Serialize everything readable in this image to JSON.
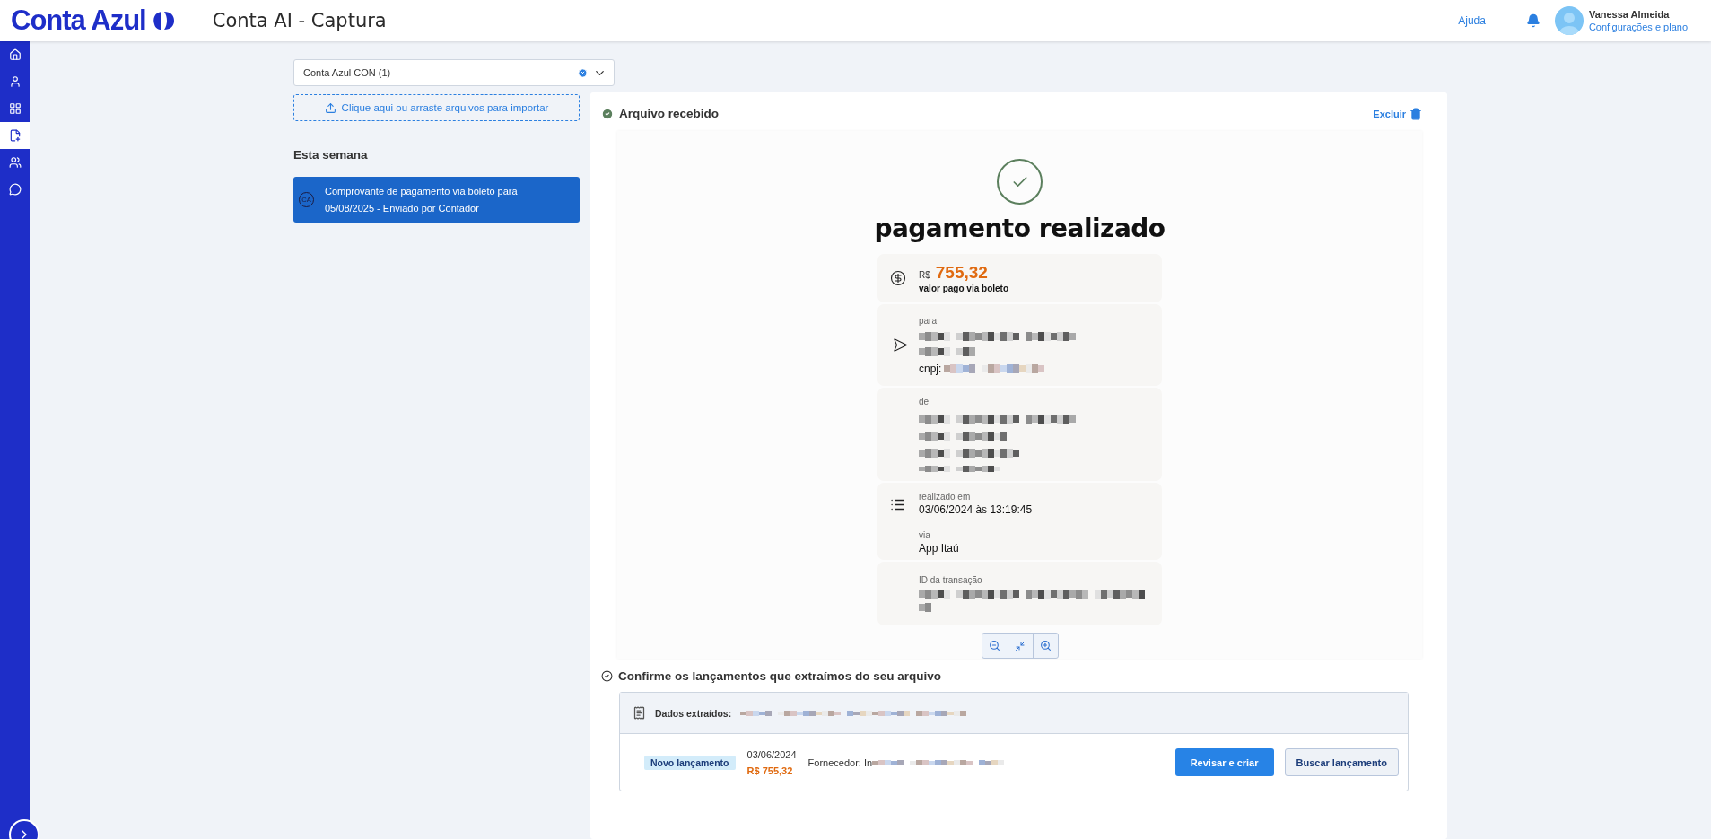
{
  "app": {
    "logo": "Conta Azul",
    "title": "Conta AI - Captura"
  },
  "header": {
    "help": "Ajuda",
    "user": {
      "name": "Vanessa Almeida",
      "link": "Configurações e plano"
    }
  },
  "sidebar": {
    "items": [
      {
        "kind": "home",
        "selected": false
      },
      {
        "kind": "user",
        "selected": false
      },
      {
        "kind": "apps",
        "selected": false
      },
      {
        "kind": "capture",
        "selected": true
      },
      {
        "kind": "contacts",
        "selected": false
      },
      {
        "kind": "chat",
        "selected": false
      }
    ]
  },
  "company_select": {
    "value": "Conta Azul CON (1)"
  },
  "upload": {
    "label": "Clique aqui ou arraste arquivos para importar"
  },
  "files": {
    "heading": "Esta semana",
    "items": [
      {
        "badge": "CA",
        "title": "Comprovante de pagamento via boleto para",
        "subtitle": "05/08/2025 - Enviado por Contador",
        "selected": true
      }
    ]
  },
  "file_panel": {
    "status": "Arquivo recebido",
    "delete": "Excluir",
    "receipt": {
      "title": "pagamento realizado",
      "currency": "R$",
      "amount": "755,32",
      "amount_label": "valor pago via boleto",
      "to_label": "para",
      "cnpj_label": "cnpj:",
      "from_label": "de",
      "date_label": "realizado em",
      "date": "03/06/2024 às 13:19:45",
      "via_label": "via",
      "via": "App Itaú",
      "id_label": "ID da transação"
    }
  },
  "confirm": {
    "heading": "Confirme os lançamentos que extraímos do seu arquivo",
    "extracted_label": "Dados extraídos:",
    "entries": [
      {
        "tag": "Novo lançamento",
        "date": "03/06/2024",
        "amount": "R$ 755,32",
        "supplier": "Fornecedor: In",
        "primary": "Revisar e criar",
        "secondary": "Buscar lançamento"
      }
    ]
  }
}
